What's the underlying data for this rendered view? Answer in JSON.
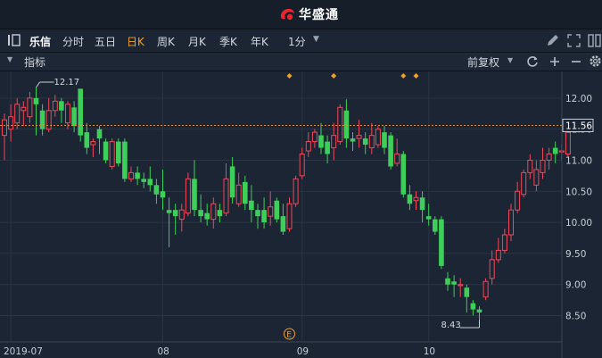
{
  "app": {
    "title": "华盛通",
    "logo_icon": "huasheng-logo-icon",
    "brand_color": "#e8262f"
  },
  "toolbar": {
    "stock_name": "乐信",
    "periods": [
      {
        "label": "分时",
        "active": false
      },
      {
        "label": "五日",
        "active": false
      },
      {
        "label": "日K",
        "active": true
      },
      {
        "label": "周K",
        "active": false
      },
      {
        "label": "月K",
        "active": false
      },
      {
        "label": "季K",
        "active": false
      },
      {
        "label": "年K",
        "active": false
      }
    ],
    "minute_select": "1分",
    "right_icons": [
      "pencil-icon",
      "expand-icon",
      "grid-icon"
    ],
    "active_color": "#f0a030"
  },
  "indicator_bar": {
    "label": "指标",
    "adjust": "前复权",
    "icons": [
      "refresh-icon",
      "plus-icon",
      "minus-icon",
      "gear-icon"
    ]
  },
  "chart_data": {
    "type": "candlestick",
    "y_ticks": [
      "12.00",
      "11.50",
      "11.00",
      "10.50",
      "10.00",
      "9.50",
      "9.00",
      "8.50"
    ],
    "ylim": [
      8.12,
      12.4
    ],
    "x_labels": [
      {
        "label": "2019-07",
        "index": 1
      },
      {
        "label": "08",
        "index": 25
      },
      {
        "label": "09",
        "index": 47
      },
      {
        "label": "10",
        "index": 67
      }
    ],
    "current_price": "11.56",
    "max_label": "12.17",
    "min_label": "8.43",
    "up_color": "#f0485a",
    "down_color": "#3ecf5a",
    "event_markers": [
      45,
      52,
      63,
      65
    ],
    "earnings_marker": {
      "label": "E",
      "index": 45
    },
    "candles": [
      [
        11.4,
        11.65,
        11.75,
        11.0
      ],
      [
        11.5,
        11.7,
        11.9,
        11.3
      ],
      [
        11.6,
        11.9,
        12.0,
        11.5
      ],
      [
        11.8,
        11.85,
        11.95,
        11.55
      ],
      [
        11.7,
        12.0,
        12.1,
        11.6
      ],
      [
        12.0,
        11.9,
        12.17,
        11.4
      ],
      [
        11.8,
        11.5,
        11.9,
        11.4
      ],
      [
        11.5,
        11.8,
        12.0,
        11.45
      ],
      [
        11.8,
        11.95,
        12.05,
        11.7
      ],
      [
        11.95,
        11.8,
        12.0,
        11.6
      ],
      [
        11.6,
        11.9,
        11.95,
        11.5
      ],
      [
        11.85,
        11.55,
        11.95,
        11.45
      ],
      [
        12.15,
        11.4,
        12.15,
        11.3
      ],
      [
        11.45,
        11.2,
        11.6,
        11.1
      ],
      [
        11.25,
        11.3,
        11.35,
        11.05
      ],
      [
        11.5,
        11.35,
        11.55,
        11.1
      ],
      [
        11.3,
        11.0,
        11.35,
        10.95
      ],
      [
        10.9,
        11.3,
        11.35,
        10.85
      ],
      [
        11.3,
        10.95,
        11.35,
        10.9
      ],
      [
        11.3,
        10.7,
        11.35,
        10.65
      ],
      [
        10.7,
        10.8,
        10.9,
        10.65
      ],
      [
        10.8,
        10.7,
        10.9,
        10.6
      ],
      [
        10.7,
        10.65,
        10.8,
        10.55
      ],
      [
        10.7,
        10.6,
        10.9,
        10.5
      ],
      [
        10.6,
        10.45,
        10.7,
        10.3
      ],
      [
        10.5,
        10.4,
        10.85,
        10.2
      ],
      [
        10.2,
        10.15,
        10.4,
        9.6
      ],
      [
        10.2,
        10.1,
        10.3,
        9.8
      ],
      [
        10.05,
        10.2,
        10.3,
        9.85
      ],
      [
        10.15,
        10.7,
        10.8,
        10.1
      ],
      [
        10.7,
        10.2,
        11.0,
        10.1
      ],
      [
        10.2,
        10.1,
        10.45,
        10.0
      ],
      [
        10.15,
        10.05,
        10.3,
        9.95
      ],
      [
        10.05,
        10.3,
        10.4,
        9.9
      ],
      [
        10.2,
        10.1,
        10.3,
        10.0
      ],
      [
        10.15,
        10.7,
        10.95,
        10.1
      ],
      [
        10.9,
        10.4,
        11.05,
        10.3
      ],
      [
        10.3,
        10.6,
        10.8,
        10.25
      ],
      [
        10.65,
        10.3,
        10.75,
        10.2
      ],
      [
        10.35,
        10.2,
        10.6,
        10.0
      ],
      [
        10.2,
        10.1,
        10.3,
        9.9
      ],
      [
        10.2,
        10.0,
        10.4,
        9.9
      ],
      [
        10.1,
        10.25,
        10.5,
        9.95
      ],
      [
        10.35,
        10.05,
        10.4,
        10.0
      ],
      [
        10.1,
        9.85,
        10.3,
        9.8
      ],
      [
        9.9,
        10.3,
        10.4,
        9.85
      ],
      [
        10.3,
        10.7,
        10.75,
        10.25
      ],
      [
        10.75,
        11.1,
        11.2,
        10.7
      ],
      [
        11.15,
        11.3,
        11.45,
        11.05
      ],
      [
        11.3,
        11.45,
        11.5,
        11.2
      ],
      [
        11.4,
        11.2,
        11.6,
        11.1
      ],
      [
        11.3,
        11.1,
        11.4,
        10.95
      ],
      [
        11.2,
        11.4,
        11.6,
        11.0
      ],
      [
        11.3,
        11.85,
        11.9,
        11.25
      ],
      [
        11.8,
        11.35,
        11.98,
        11.2
      ],
      [
        11.35,
        11.3,
        11.45,
        11.15
      ],
      [
        11.35,
        11.4,
        11.65,
        11.2
      ],
      [
        11.35,
        11.25,
        11.45,
        11.1
      ],
      [
        11.2,
        11.4,
        11.6,
        11.1
      ],
      [
        11.25,
        11.5,
        11.55,
        11.2
      ],
      [
        11.45,
        11.2,
        11.55,
        11.1
      ],
      [
        11.4,
        10.9,
        11.45,
        10.85
      ],
      [
        10.95,
        11.1,
        11.35,
        10.9
      ],
      [
        11.1,
        10.45,
        11.15,
        10.4
      ],
      [
        10.45,
        10.3,
        10.6,
        10.2
      ],
      [
        10.35,
        10.4,
        10.5,
        10.2
      ],
      [
        10.4,
        10.2,
        10.5,
        10.0
      ],
      [
        10.1,
        10.05,
        10.3,
        9.95
      ],
      [
        10.05,
        9.85,
        10.1,
        9.8
      ],
      [
        10.05,
        9.3,
        10.1,
        9.25
      ],
      [
        9.1,
        9.0,
        9.2,
        8.9
      ],
      [
        9.05,
        9.0,
        9.15,
        8.8
      ],
      [
        9.0,
        9.0,
        9.1,
        8.8
      ],
      [
        8.95,
        8.8,
        9.0,
        8.55
      ],
      [
        8.7,
        8.6,
        8.75,
        8.5
      ],
      [
        8.6,
        8.55,
        8.65,
        8.43
      ],
      [
        8.8,
        9.05,
        9.1,
        8.75
      ],
      [
        9.1,
        9.4,
        9.55,
        9.0
      ],
      [
        9.4,
        9.55,
        9.75,
        9.35
      ],
      [
        9.55,
        9.8,
        9.9,
        9.5
      ],
      [
        9.8,
        10.2,
        10.3,
        9.7
      ],
      [
        10.2,
        10.5,
        10.65,
        10.15
      ],
      [
        10.45,
        10.8,
        10.85,
        10.4
      ],
      [
        10.8,
        11.0,
        11.1,
        10.7
      ],
      [
        10.6,
        10.85,
        11.0,
        10.5
      ],
      [
        10.8,
        11.0,
        11.2,
        10.7
      ],
      [
        11.0,
        11.1,
        11.2,
        10.85
      ],
      [
        11.2,
        11.1,
        11.3,
        10.95
      ],
      [
        11.15,
        11.15,
        11.25,
        11.0
      ],
      [
        11.1,
        11.56,
        11.6,
        11.05
      ]
    ]
  }
}
